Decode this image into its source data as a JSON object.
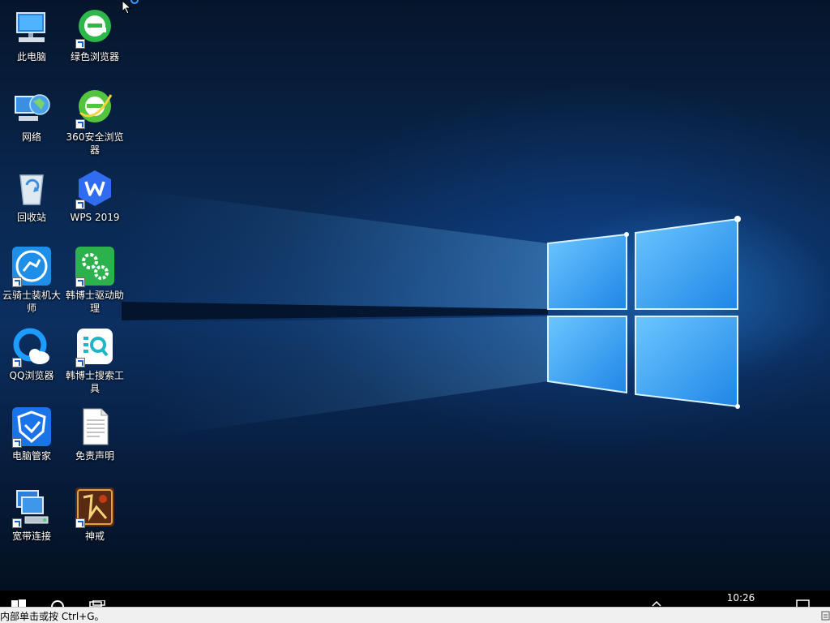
{
  "desktop": {
    "icons": [
      {
        "name": "此电脑",
        "icon": "computer-icon"
      },
      {
        "name": "绿色浏览器",
        "icon": "green-browser-icon",
        "shortcut": true
      },
      {
        "name": "网络",
        "icon": "network-icon"
      },
      {
        "name": "360安全浏览器",
        "icon": "360-browser-icon",
        "shortcut": true
      },
      {
        "name": "回收站",
        "icon": "recycle-bin-icon"
      },
      {
        "name": "WPS 2019",
        "icon": "wps-icon",
        "shortcut": true
      },
      {
        "name": "云骑士装机大师",
        "icon": "yunqishi-icon",
        "shortcut": true
      },
      {
        "name": "韩博士驱动助理",
        "icon": "driver-assistant-icon",
        "shortcut": true
      },
      {
        "name": "QQ浏览器",
        "icon": "qq-browser-icon",
        "shortcut": true
      },
      {
        "name": "韩博士搜索工具",
        "icon": "search-tool-icon",
        "shortcut": true
      },
      {
        "name": "电脑管家",
        "icon": "pc-manager-icon",
        "shortcut": true
      },
      {
        "name": "免责声明",
        "icon": "text-document-icon"
      },
      {
        "name": "宽带连接",
        "icon": "broadband-icon",
        "shortcut": true
      },
      {
        "name": "神戒",
        "icon": "shenjie-game-icon",
        "shortcut": true
      }
    ]
  },
  "taskbar": {
    "time": "10:26"
  },
  "statusbar": {
    "text": "内部单击或按 Ctrl+G。"
  },
  "colors": {
    "taskbar": "#000000",
    "statusbar": "#f0f0f0",
    "label": "#ffffff"
  }
}
